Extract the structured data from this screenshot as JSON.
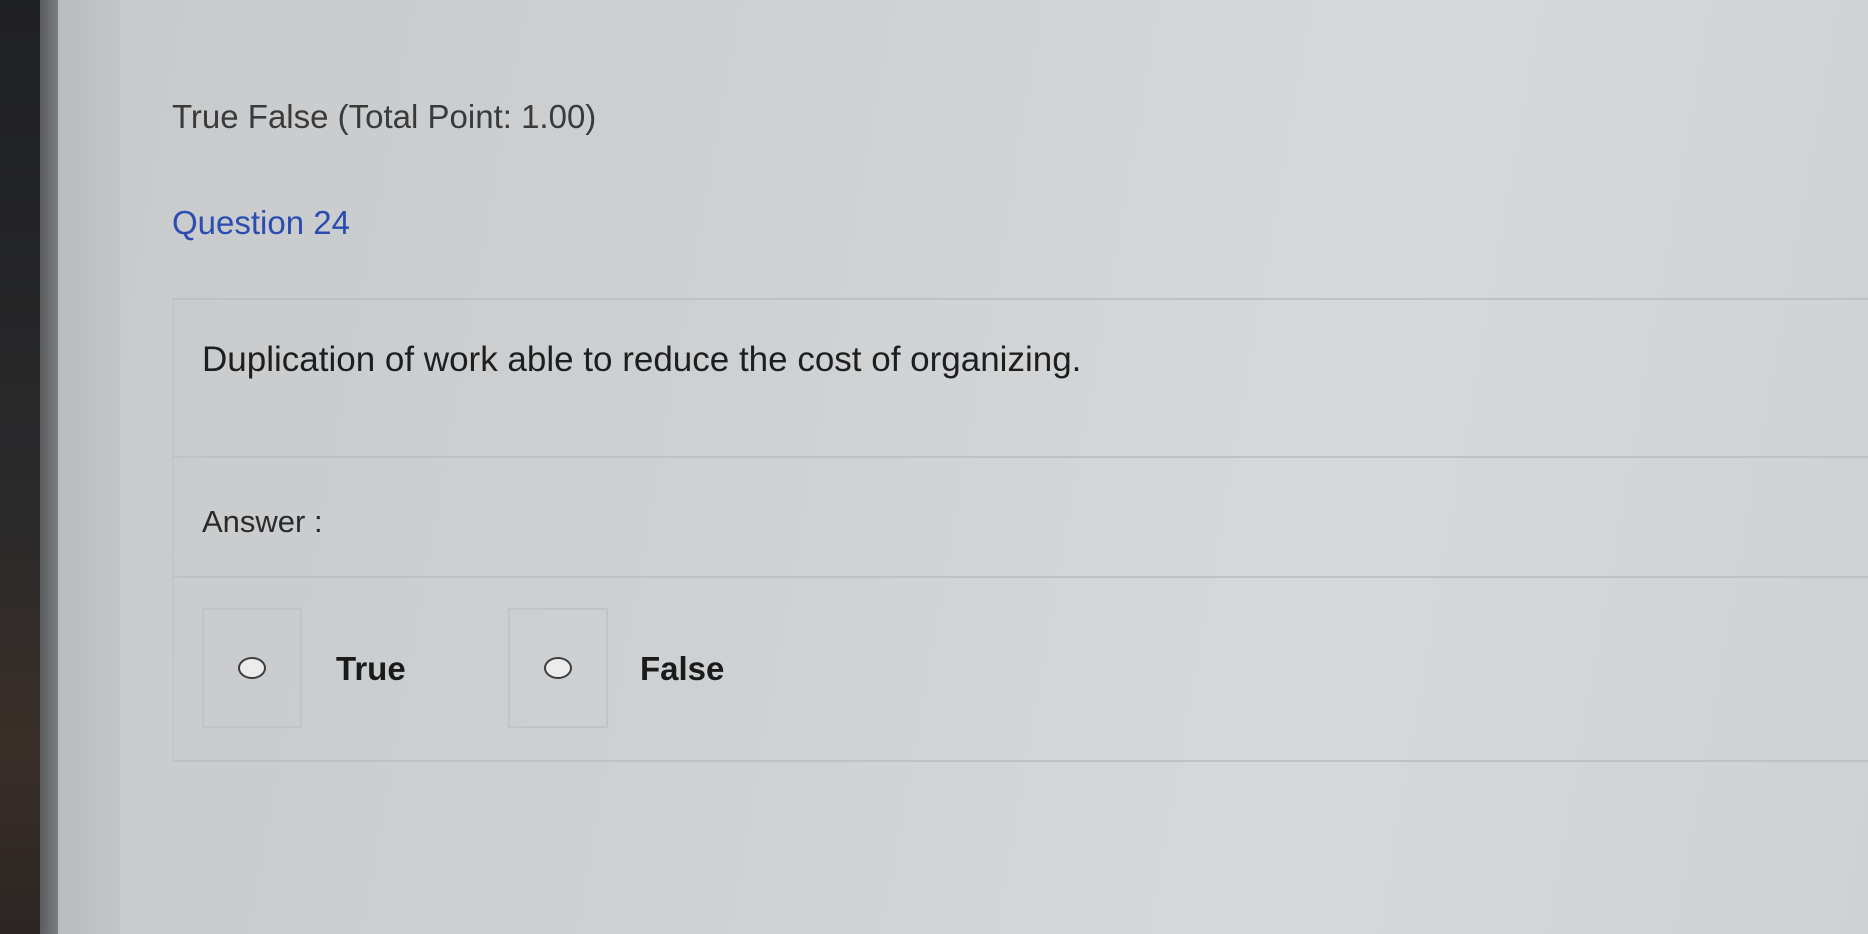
{
  "quiz": {
    "section_title": "True False (Total Point: 1.00)",
    "question_number": "Question 24",
    "question_text": "Duplication of work able to reduce the cost of organizing.",
    "answer_label": "Answer :",
    "options": [
      {
        "label": "True",
        "selected": false
      },
      {
        "label": "False",
        "selected": false
      }
    ]
  },
  "colors": {
    "question_number": "#2b4cb0",
    "background": "#cdd0d2"
  }
}
